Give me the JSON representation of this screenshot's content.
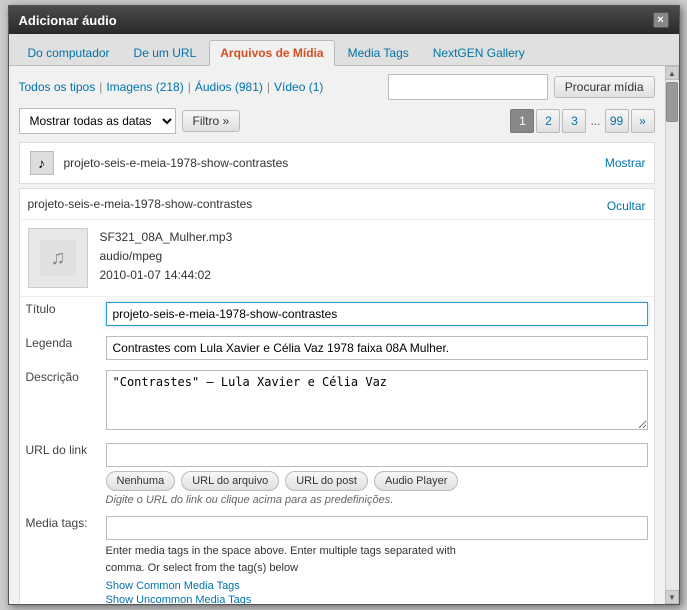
{
  "dialog": {
    "title": "Adicionar áudio",
    "close_label": "×"
  },
  "tabs": [
    {
      "label": "Do computador",
      "active": false
    },
    {
      "label": "De um URL",
      "active": false
    },
    {
      "label": "Arquivos de Mídia",
      "active": true
    },
    {
      "label": "Media Tags",
      "active": false
    },
    {
      "label": "NextGEN Gallery",
      "active": false
    }
  ],
  "filter": {
    "all_types_label": "Todos os tipos",
    "images_label": "Imagens (218)",
    "audios_label": "Áudios (981)",
    "video_label": "Vídeo (1)",
    "search_placeholder": "",
    "search_button": "Procurar mídia",
    "date_filter": "Mostrar todas as datas",
    "filter_button": "Filtro »"
  },
  "pagination": {
    "pages": [
      "1",
      "2",
      "3",
      "...",
      "99",
      "»"
    ]
  },
  "media_item1": {
    "name": "projeto-seis-e-meia-1978-show-contrastes",
    "show_label": "Mostrar"
  },
  "media_item2": {
    "name": "projeto-seis-e-meia-1978-show-contrastes",
    "hide_label": "Ocultar"
  },
  "media_detail": {
    "filename": "SF321_08A_Mulher.mp3",
    "type": "audio/mpeg",
    "date": "2010-01-07 14:44:02"
  },
  "form": {
    "title_label": "Título",
    "title_value": "projeto-seis-e-meia-1978-show-contrastes",
    "caption_label": "Legenda",
    "caption_value": "Contrastes com Lula Xavier e Célia Vaz 1978 faixa 08A Mulher.",
    "desc_label": "Descrição",
    "desc_value": "\"Contrastes\" – Lula Xavier e Célia Vaz",
    "url_label": "URL do link",
    "url_value": "",
    "url_btns": [
      "Nenhuma",
      "URL do arquivo",
      "URL do post",
      "Audio Player"
    ],
    "url_hint": "Digite o URL do link ou clique acima para as predefinições.",
    "media_tags_label": "Media tags:",
    "media_tags_value": "",
    "media_tags_hint1": "Enter media tags in the space above. Enter multiple tags separated with",
    "media_tags_hint2": "comma. Or select from the tag(s) below",
    "show_common_tags": "Show Common Media Tags",
    "show_uncommon_tags": "Show Uncommon Media Tags"
  }
}
